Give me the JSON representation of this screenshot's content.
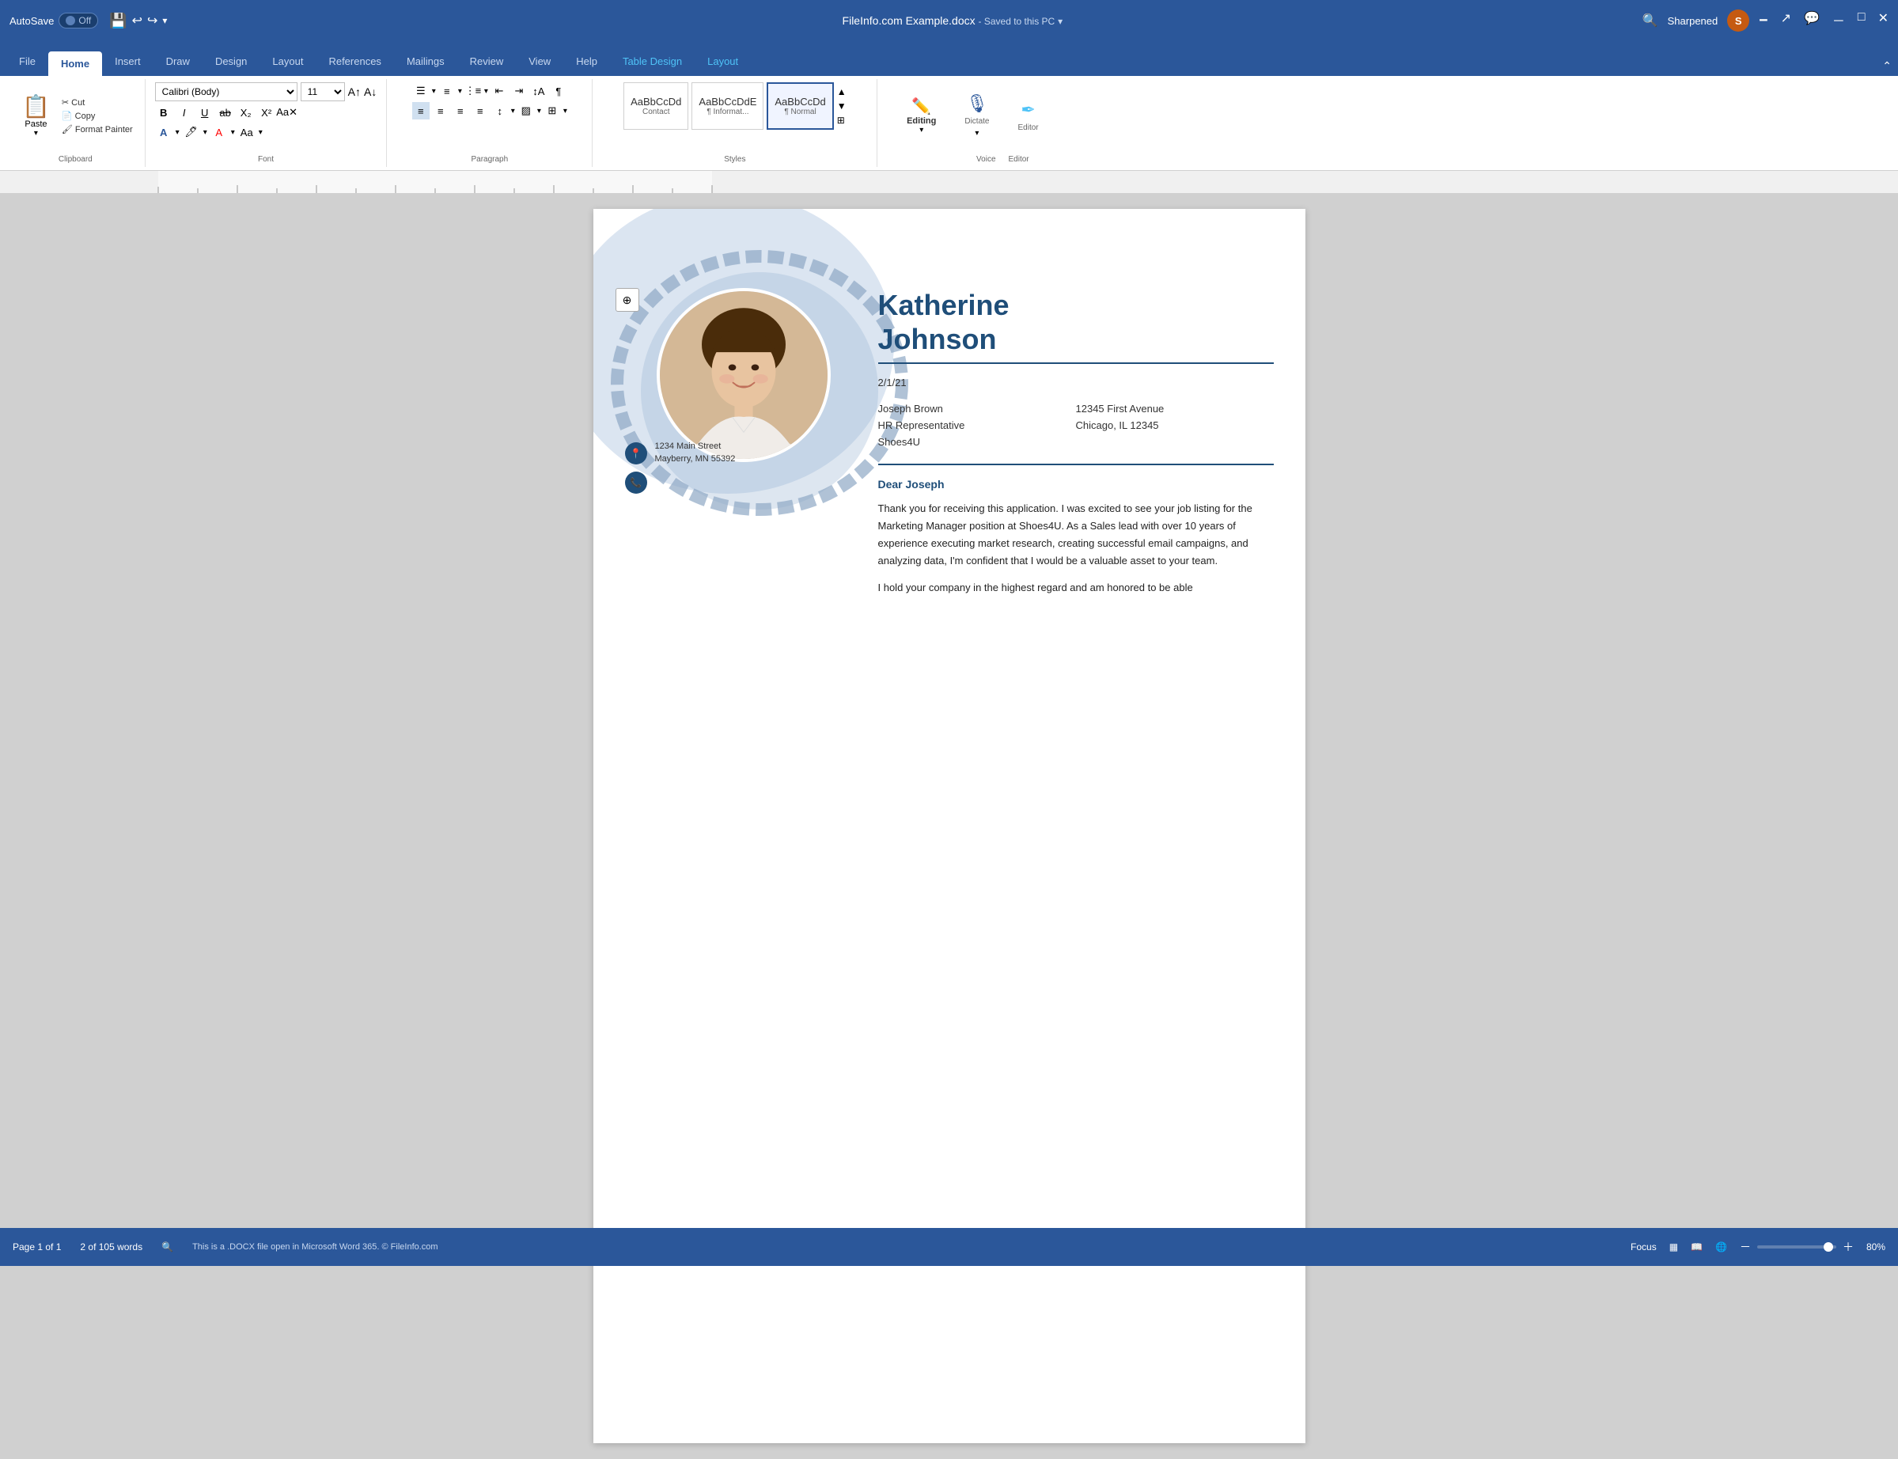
{
  "titlebar": {
    "autosave_label": "AutoSave",
    "toggle_label": "Off",
    "filename": "FileInfo.com Example.docx",
    "saved_status": "Saved to this PC",
    "user_initial": "S",
    "user_name": "Sharpened",
    "search_placeholder": "Search"
  },
  "ribbon_tabs": [
    {
      "id": "file",
      "label": "File",
      "active": false
    },
    {
      "id": "home",
      "label": "Home",
      "active": true
    },
    {
      "id": "insert",
      "label": "Insert",
      "active": false
    },
    {
      "id": "draw",
      "label": "Draw",
      "active": false
    },
    {
      "id": "design",
      "label": "Design",
      "active": false
    },
    {
      "id": "layout",
      "label": "Layout",
      "active": false
    },
    {
      "id": "references",
      "label": "References",
      "active": false
    },
    {
      "id": "mailings",
      "label": "Mailings",
      "active": false
    },
    {
      "id": "review",
      "label": "Review",
      "active": false
    },
    {
      "id": "view",
      "label": "View",
      "active": false
    },
    {
      "id": "help",
      "label": "Help",
      "active": false
    },
    {
      "id": "table_design",
      "label": "Table Design",
      "active": false,
      "accent": true
    },
    {
      "id": "layout2",
      "label": "Layout",
      "active": false,
      "accent": true
    }
  ],
  "ribbon": {
    "clipboard": {
      "label": "Clipboard",
      "paste_label": "Paste",
      "cut_label": "Cut",
      "copy_label": "Copy",
      "format_painter_label": "Format Painter"
    },
    "font": {
      "label": "Font",
      "font_name": "Calibri (Body)",
      "font_size": "11",
      "bold": "B",
      "italic": "I",
      "underline": "U"
    },
    "paragraph": {
      "label": "Paragraph"
    },
    "styles": {
      "label": "Styles",
      "items": [
        {
          "label": "AaBbCcDd",
          "sublabel": "Contact",
          "selected": false
        },
        {
          "label": "AaBbCcDdE",
          "sublabel": "¶ Informat...",
          "selected": false
        },
        {
          "label": "AaBbCcDd",
          "sublabel": "¶ Normal",
          "selected": true
        }
      ]
    },
    "voice": {
      "label": "Voice",
      "dictate_label": "Dictate"
    },
    "editor": {
      "label": "Editor",
      "editing_label": "Editing"
    }
  },
  "document": {
    "person_name": "Katherine\nJohnson",
    "name_line1": "Katherine",
    "name_line2": "Johnson",
    "date": "2/1/21",
    "recipient": {
      "name": "Joseph Brown",
      "title": "HR Representative",
      "company": "Shoes4U",
      "address": "12345 First Avenue",
      "city_state": "Chicago, IL 12345"
    },
    "salutation": "Dear Joseph",
    "paragraphs": [
      "Thank you for receiving this application.  I was excited to see your job listing for the Marketing Manager position at Shoes4U.  As a Sales lead with over 10 years of experience executing market research, creating successful email campaigns, and analyzing data, I'm confident that I would be a valuable asset to your team.",
      "I hold your company in the highest regard and am honored to be able"
    ],
    "contact": {
      "address_line1": "1234 Main Street",
      "address_line2": "Mayberry, MN 55392"
    }
  },
  "statusbar": {
    "page_info": "Page 1 of 1",
    "word_count": "2 of 105 words",
    "check_icon": "🔍",
    "notification": "This is a .DOCX file open in Microsoft Word 365. © FileInfo.com",
    "focus_label": "Focus",
    "view_label": "▦",
    "zoom_level": "80%"
  }
}
